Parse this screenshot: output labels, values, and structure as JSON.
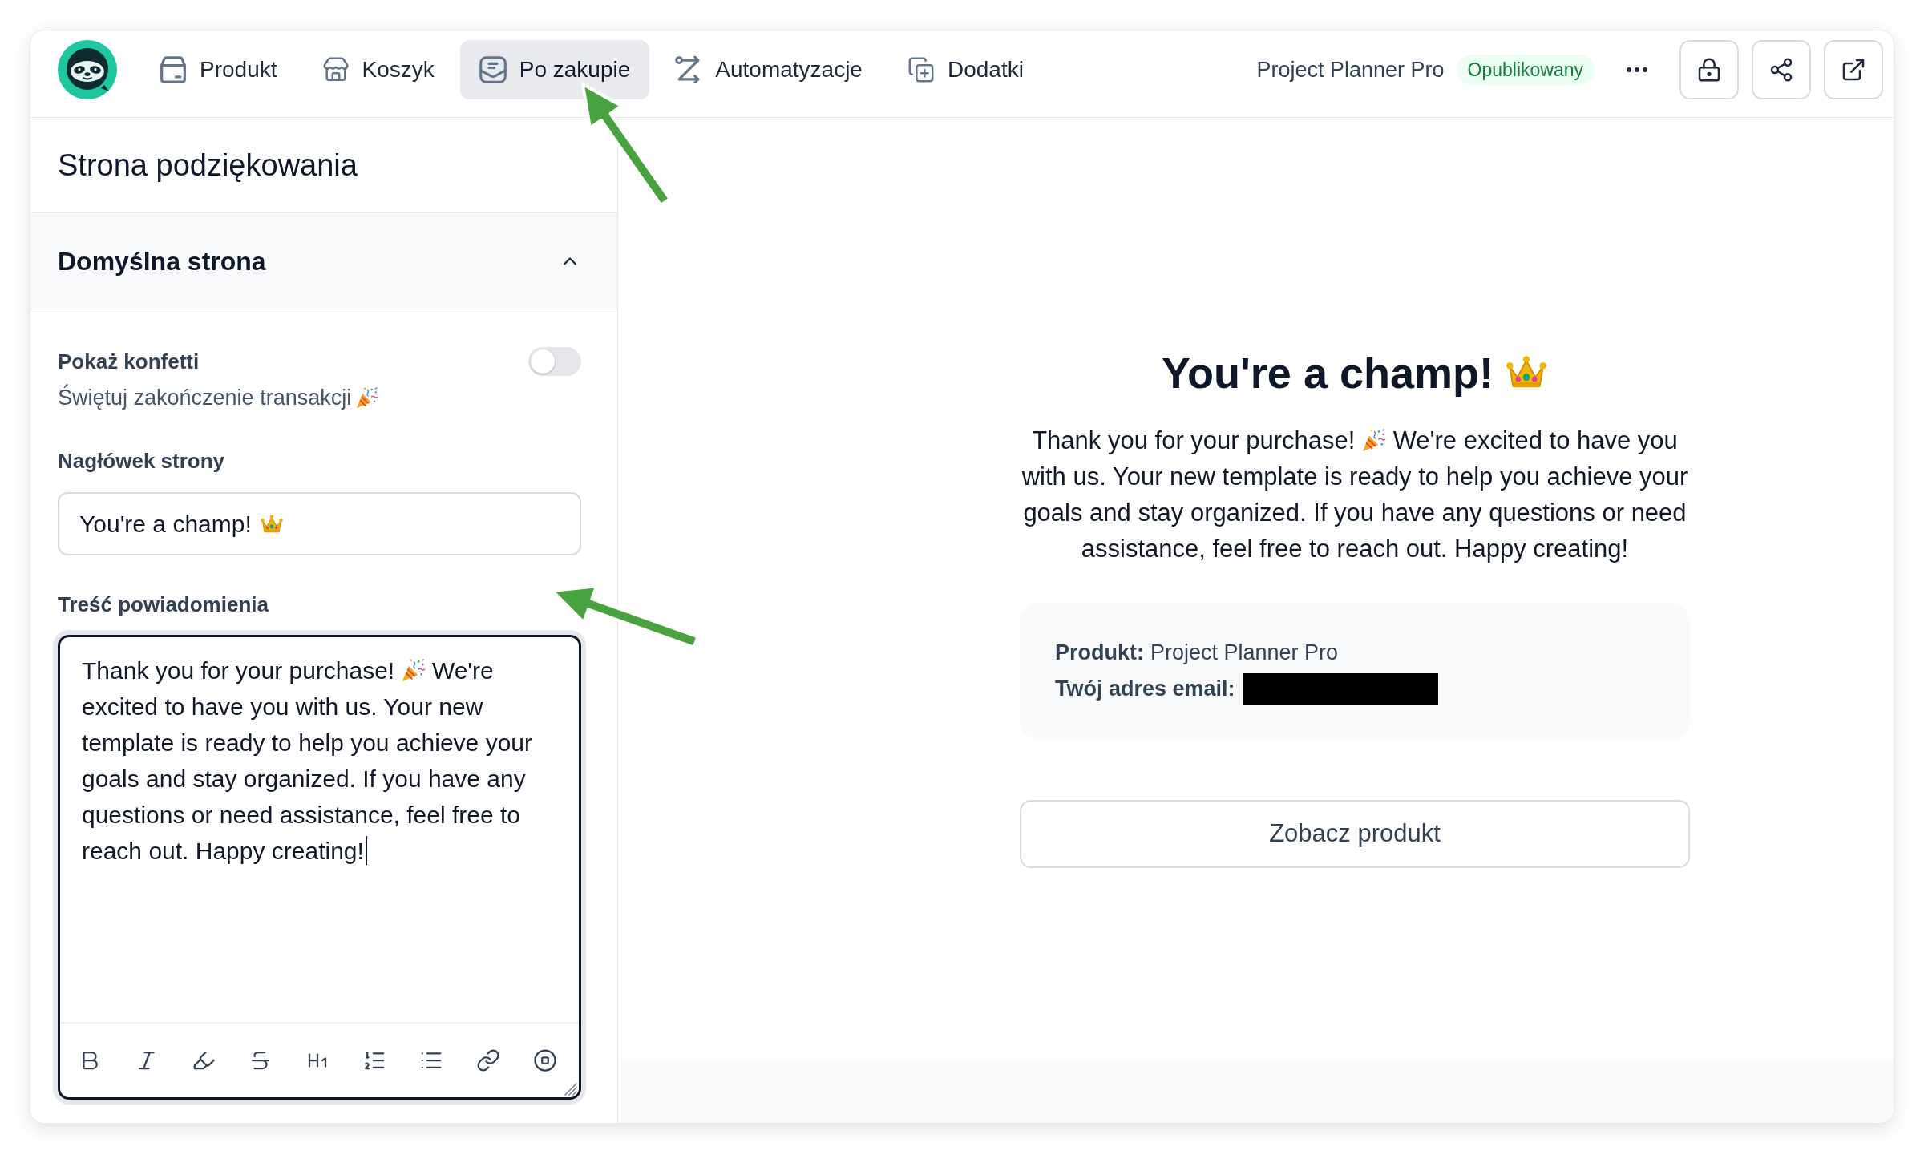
{
  "header": {
    "tabs": [
      {
        "label": "Produkt",
        "selected": false
      },
      {
        "label": "Koszyk",
        "selected": false
      },
      {
        "label": "Po zakupie",
        "selected": true
      },
      {
        "label": "Automatyzacje",
        "selected": false
      },
      {
        "label": "Dodatki",
        "selected": false
      }
    ],
    "product_name": "Project Planner Pro",
    "status_badge": "Opublikowany"
  },
  "editor": {
    "title": "Strona podziękowania",
    "section": {
      "title": "Domyślna strona",
      "expanded": true
    },
    "confetti": {
      "label": "Pokaż konfetti",
      "description": "Świętuj zakończenie transakcji",
      "on": false
    },
    "heading_field": {
      "label": "Nagłówek strony",
      "value": "You're a champ!"
    },
    "message_field": {
      "label": "Treść powiadomienia",
      "text_parts": [
        "Thank you for your purchase!",
        "We're excited to have you with us. Your new template is ready to help you achieve your goals and stay organized. If you have any questions or need assistance, feel free to reach out. Happy creating!"
      ],
      "focused": true
    }
  },
  "preview": {
    "heading": "You're a champ!",
    "message_parts": [
      "Thank you for your purchase!",
      "We're excited to have you with us. Your new template is ready to help you achieve your goals and stay organized. If you have any questions or need assistance, feel free to reach out. Happy creating!"
    ],
    "details": [
      {
        "kind": "text",
        "label": "Produkt:",
        "value": "Project Planner Pro"
      },
      {
        "kind": "redacted",
        "label": "Twój adres email:"
      }
    ],
    "button": "Zobacz produkt"
  }
}
